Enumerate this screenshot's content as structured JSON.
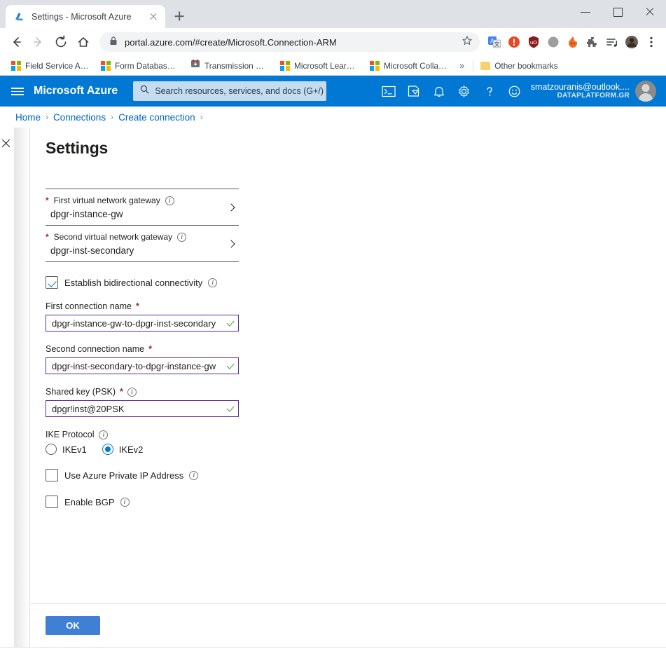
{
  "browser": {
    "tab": {
      "title": "Settings - Microsoft Azure",
      "favicon": "azure-logo-icon",
      "close_icon": "close-icon"
    },
    "new_tab_icon": "plus-icon",
    "window_controls": {
      "minimize": "minimize-icon",
      "maximize": "maximize-icon",
      "close": "close-icon"
    },
    "nav": {
      "back": "back-arrow-icon",
      "forward": "forward-arrow-icon",
      "reload": "reload-icon",
      "home": "home-icon"
    },
    "omnibox": {
      "lock_icon": "lock-icon",
      "url": "portal.azure.com/#create/Microsoft.Connection-ARM",
      "star_icon": "star-icon"
    },
    "toolbar_icons": [
      "translate-icon",
      "alert-icon",
      "ublock-icon",
      "gray-circle-icon",
      "hot-extension-icon",
      "extensions-puzzle-icon",
      "reading-list-icon",
      "profile-avatar-icon",
      "chrome-menu-icon"
    ],
    "bookmarks": [
      {
        "label": "Field Service Admin...",
        "icon": "microsoft-logo-icon"
      },
      {
        "label": "Form Database Trai...",
        "icon": "microsoft-logo-icon"
      },
      {
        "label": "Transmission Web I...",
        "icon": "transmission-icon"
      },
      {
        "label": "Microsoft Learning...",
        "icon": "microsoft-logo-icon"
      },
      {
        "label": "Microsoft Collabora...",
        "icon": "microsoft-logo-icon"
      }
    ],
    "bookmarks_overflow": "»",
    "other_bookmarks": {
      "label": "Other bookmarks",
      "icon": "folder-icon"
    }
  },
  "azure_header": {
    "menu_icon": "hamburger-menu-icon",
    "brand": "Microsoft Azure",
    "search": {
      "placeholder": "Search resources, services, and docs (G+/)",
      "icon": "search-icon"
    },
    "icons": [
      "cloud-shell-icon",
      "directories-subscriptions-icon",
      "notifications-bell-icon",
      "settings-gear-icon",
      "help-question-icon",
      "feedback-smiley-icon"
    ],
    "account": {
      "name": "smatzouranis@outlook....",
      "org": "DATAPLATFORM.GR",
      "avatar": "user-avatar-icon"
    },
    "accent_color": "#0078d4"
  },
  "breadcrumb": {
    "items": [
      "Home",
      "Connections",
      "Create connection"
    ],
    "separator": "›"
  },
  "blade": {
    "close_icon": "close-icon",
    "title": "Settings",
    "gateway_fields": [
      {
        "label": "First virtual network gateway",
        "required_marker": "*",
        "info_icon": "info-icon",
        "value": "dpgr-instance-gw",
        "chevron_icon": "chevron-right-icon"
      },
      {
        "label": "Second virtual network gateway",
        "required_marker": "*",
        "info_icon": "info-icon",
        "value": "dpgr-inst-secondary",
        "chevron_icon": "chevron-right-icon"
      }
    ],
    "bidirectional": {
      "label": "Establish bidirectional connectivity",
      "checked": true,
      "info_icon": "info-icon",
      "check_color": "#0078d4"
    },
    "text_fields": [
      {
        "label": "First connection name",
        "required_marker": "*",
        "value": "dpgr-instance-gw-to-dpgr-inst-secondary",
        "valid_icon": "check-icon",
        "border_color": "#5c2d91"
      },
      {
        "label": "Second connection name",
        "required_marker": "*",
        "value": "dpgr-inst-secondary-to-dpgr-instance-gw",
        "valid_icon": "check-icon",
        "border_color": "#5c2d91"
      },
      {
        "label": "Shared key (PSK)",
        "required_marker": "*",
        "info_icon": "info-icon",
        "value": "dpgr!inst@20PSK",
        "valid_icon": "check-icon",
        "border_color": "#5c2d91"
      }
    ],
    "ike_protocol": {
      "label": "IKE Protocol",
      "info_icon": "info-icon",
      "options": [
        {
          "label": "IKEv1",
          "selected": false
        },
        {
          "label": "IKEv2",
          "selected": true
        }
      ],
      "selected_color": "#0078d4"
    },
    "checkboxes": [
      {
        "label": "Use Azure Private IP Address",
        "checked": false,
        "info_icon": "info-icon"
      },
      {
        "label": "Enable BGP",
        "checked": false,
        "info_icon": "info-icon"
      }
    ],
    "footer": {
      "ok_label": "OK",
      "ok_color": "#3f7fd6"
    }
  }
}
